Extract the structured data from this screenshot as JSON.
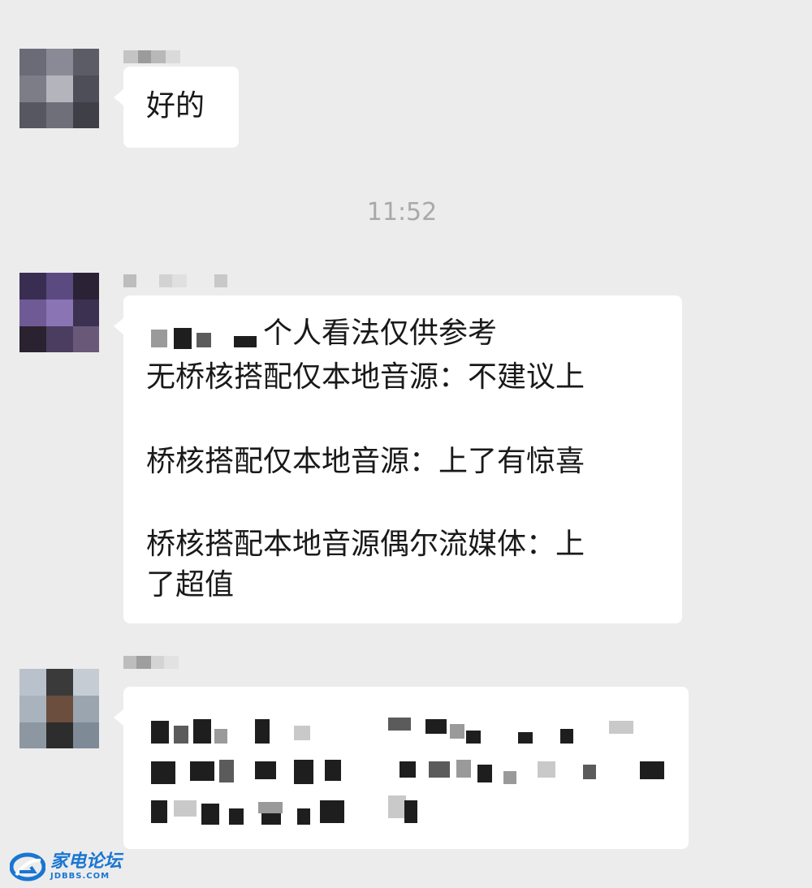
{
  "messages": [
    {
      "sender": "redacted",
      "text": "好的"
    },
    {
      "timestamp": "11:52"
    },
    {
      "sender": "redacted",
      "lines": [
        "个人看法仅供参考",
        "无桥核搭配仅本地音源：不建议上",
        "",
        "桥核搭配仅本地音源：上了有惊喜",
        "",
        "桥核搭配本地音源偶尔流媒体：上",
        "了超值"
      ]
    },
    {
      "sender": "redacted",
      "text": ""
    }
  ],
  "watermark": {
    "name": "家电论坛",
    "domain": "JDBBS.COM",
    "color": "#1976d2"
  },
  "colors": {
    "background": "#ececec",
    "bubble": "#ffffff",
    "timestamp": "#a9a9a9"
  }
}
